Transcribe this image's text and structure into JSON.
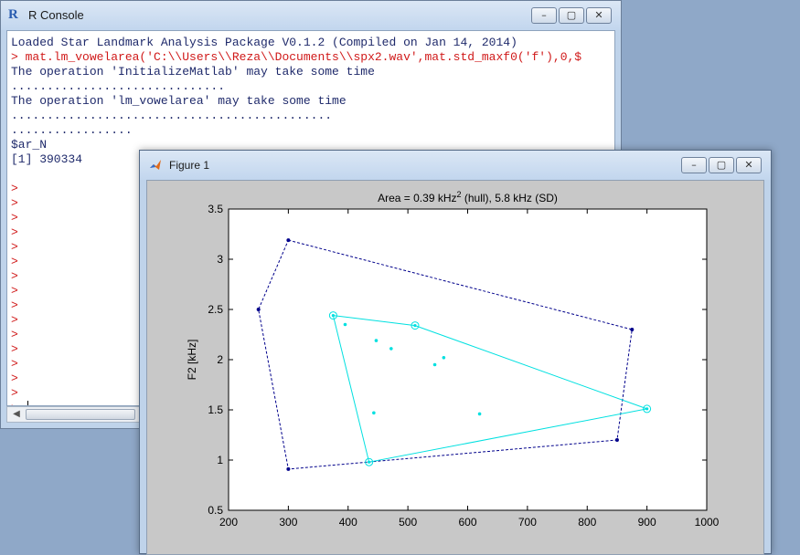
{
  "console": {
    "title": "R Console",
    "app_icon": "R",
    "lines": [
      {
        "text": "Loaded Star Landmark Analysis Package V0.1.2 (Compiled on Jan 14, 2014)",
        "color": "navy"
      },
      {
        "text": "> mat.lm_vowelarea('C:\\\\Users\\\\Reza\\\\Documents\\\\spx2.wav',mat.std_maxf0('f'),0,$",
        "color": "red"
      },
      {
        "text": "The operation 'InitializeMatlab' may take some time",
        "color": "navy"
      },
      {
        "text": "..............................",
        "color": "navy"
      },
      {
        "text": "The operation 'lm_vowelarea' may take some time",
        "color": "navy"
      },
      {
        "text": ".............................................",
        "color": "navy"
      },
      {
        "text": ".................",
        "color": "navy"
      },
      {
        "text": "$ar_N",
        "color": "navy"
      },
      {
        "text": "[1] 390334",
        "color": "navy"
      },
      {
        "text": "",
        "color": "navy"
      },
      {
        "text": ">",
        "color": "red"
      },
      {
        "text": ">",
        "color": "red"
      },
      {
        "text": ">",
        "color": "red"
      },
      {
        "text": ">",
        "color": "red"
      },
      {
        "text": ">",
        "color": "red"
      },
      {
        "text": ">",
        "color": "red"
      },
      {
        "text": ">",
        "color": "red"
      },
      {
        "text": ">",
        "color": "red"
      },
      {
        "text": ">",
        "color": "red"
      },
      {
        "text": ">",
        "color": "red"
      },
      {
        "text": ">",
        "color": "red"
      },
      {
        "text": ">",
        "color": "red"
      },
      {
        "text": ">",
        "color": "red"
      },
      {
        "text": ">",
        "color": "red"
      },
      {
        "text": ">",
        "color": "red"
      },
      {
        "text": "> ",
        "color": "red",
        "cursor": true
      }
    ]
  },
  "figure": {
    "title": "Figure 1"
  },
  "window_buttons": {
    "minimize": "–",
    "maximize": "▢",
    "close": "✕"
  },
  "colors": {
    "navy": "#1f2a6b",
    "red": "#d01919",
    "outer_polygon": "#00008b",
    "inner_polygon": "#00e0e0"
  },
  "chart_data": {
    "type": "scatter",
    "title_prefix": "Area = 0.39 kHz",
    "title_superscript": "2",
    "title_suffix": " (hull), 5.8 kHz (SD)",
    "xlabel": "",
    "ylabel": "F2 [kHz]",
    "xlim": [
      200,
      1000
    ],
    "ylim": [
      0.5,
      3.5
    ],
    "xticks": [
      200,
      300,
      400,
      500,
      600,
      700,
      800,
      900,
      1000
    ],
    "yticks": [
      0.5,
      1,
      1.5,
      2,
      2.5,
      3,
      3.5
    ],
    "grid": false,
    "series": [
      {
        "style": "dashed-polygon",
        "color": "#00008b",
        "points": [
          [
            300,
            3.19
          ],
          [
            875,
            2.3
          ],
          [
            850,
            1.2
          ],
          [
            300,
            0.91
          ],
          [
            250,
            2.5
          ]
        ]
      },
      {
        "style": "hull-polygon",
        "color": "#00e0e0",
        "points": [
          [
            375,
            2.44
          ],
          [
            512,
            2.34
          ],
          [
            900,
            1.51
          ],
          [
            435,
            0.98
          ]
        ]
      },
      {
        "style": "inner-points",
        "color": "#00e0e0",
        "points": [
          [
            395,
            2.35
          ],
          [
            447,
            2.19
          ],
          [
            472,
            2.11
          ],
          [
            560,
            2.02
          ],
          [
            545,
            1.95
          ],
          [
            443,
            1.47
          ],
          [
            620,
            1.46
          ]
        ]
      }
    ]
  }
}
